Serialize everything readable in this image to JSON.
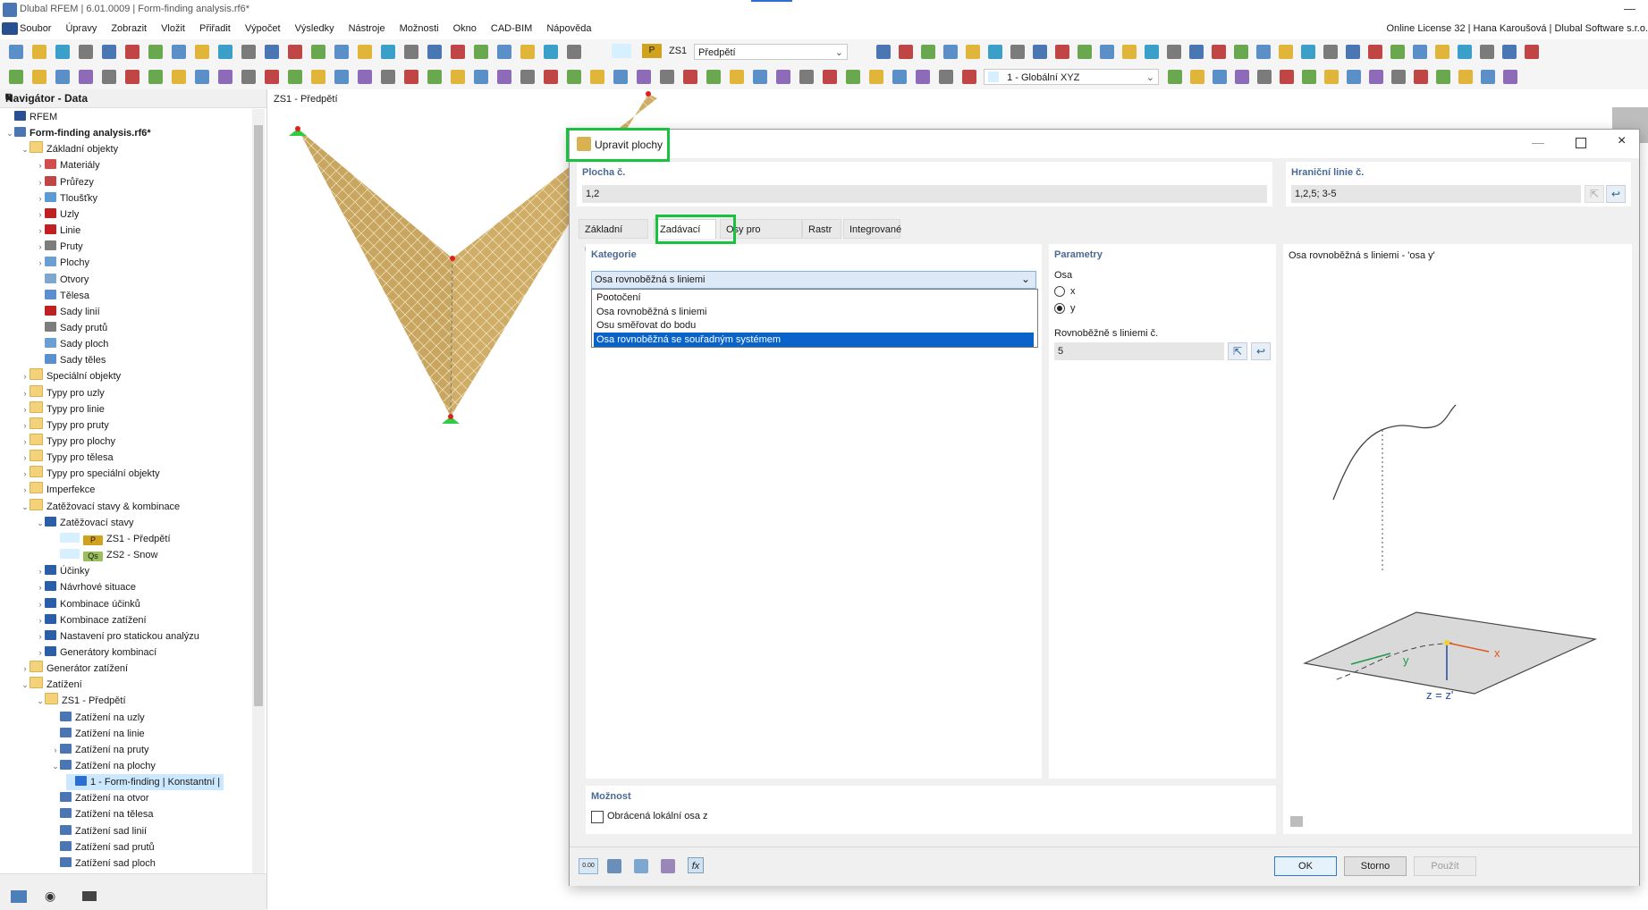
{
  "window": {
    "title": "Dlubal RFEM | 6.01.0009 | Form-finding analysis.rf6*"
  },
  "menu": {
    "items": [
      "Soubor",
      "Úpravy",
      "Zobrazit",
      "Vložit",
      "Přiřadit",
      "Výpočet",
      "Výsledky",
      "Nástroje",
      "Možnosti",
      "Okno",
      "CAD-BIM",
      "Nápověda"
    ],
    "license": "Online License 32 | Hana Karoušová | Dlubal Software s.r.o."
  },
  "toolbar": {
    "load_case_badge": "P",
    "load_case_code": "ZS1",
    "load_case_name": "Předpětí",
    "coord_system": "1 - Globální XYZ"
  },
  "navigator": {
    "title": "Navigátor - Data",
    "rows": [
      {
        "label": "RFEM",
        "indent": 0,
        "tw": "",
        "icon": "rfem",
        "bold": false
      },
      {
        "label": "Form-finding analysis.rf6*",
        "indent": 0,
        "tw": "v",
        "icon": "file",
        "bold": true
      },
      {
        "label": "Základní objekty",
        "indent": 1,
        "tw": "v",
        "icon": "folder"
      },
      {
        "label": "Materiály",
        "indent": 2,
        "tw": ">",
        "icon": "mat"
      },
      {
        "label": "Průřezy",
        "indent": 2,
        "tw": ">",
        "icon": "sec"
      },
      {
        "label": "Tloušťky",
        "indent": 2,
        "tw": ">",
        "icon": "thk"
      },
      {
        "label": "Uzly",
        "indent": 2,
        "tw": ">",
        "icon": "node"
      },
      {
        "label": "Linie",
        "indent": 2,
        "tw": ">",
        "icon": "line"
      },
      {
        "label": "Pruty",
        "indent": 2,
        "tw": ">",
        "icon": "member"
      },
      {
        "label": "Plochy",
        "indent": 2,
        "tw": ">",
        "icon": "surf"
      },
      {
        "label": "Otvory",
        "indent": 2,
        "tw": "",
        "icon": "open"
      },
      {
        "label": "Tělesa",
        "indent": 2,
        "tw": "",
        "icon": "solid"
      },
      {
        "label": "Sady linií",
        "indent": 2,
        "tw": "",
        "icon": "line"
      },
      {
        "label": "Sady prutů",
        "indent": 2,
        "tw": "",
        "icon": "member"
      },
      {
        "label": "Sady ploch",
        "indent": 2,
        "tw": "",
        "icon": "surf"
      },
      {
        "label": "Sady těles",
        "indent": 2,
        "tw": "",
        "icon": "solid"
      },
      {
        "label": "Speciální objekty",
        "indent": 1,
        "tw": ">",
        "icon": "folder"
      },
      {
        "label": "Typy pro uzly",
        "indent": 1,
        "tw": ">",
        "icon": "folder"
      },
      {
        "label": "Typy pro linie",
        "indent": 1,
        "tw": ">",
        "icon": "folder"
      },
      {
        "label": "Typy pro pruty",
        "indent": 1,
        "tw": ">",
        "icon": "folder"
      },
      {
        "label": "Typy pro plochy",
        "indent": 1,
        "tw": ">",
        "icon": "folder"
      },
      {
        "label": "Typy pro tělesa",
        "indent": 1,
        "tw": ">",
        "icon": "folder"
      },
      {
        "label": "Typy pro speciální objekty",
        "indent": 1,
        "tw": ">",
        "icon": "folder"
      },
      {
        "label": "Imperfekce",
        "indent": 1,
        "tw": ">",
        "icon": "folder"
      },
      {
        "label": "Zatěžovací stavy & kombinace",
        "indent": 1,
        "tw": "v",
        "icon": "folder"
      },
      {
        "label": "Zatěžovací stavy",
        "indent": 2,
        "tw": "v",
        "icon": "lc"
      },
      {
        "label": "ZS1 - Předpětí",
        "indent": 3,
        "tw": "",
        "icon": "badgeP",
        "badge": "P"
      },
      {
        "label": "ZS2 - Snow",
        "indent": 3,
        "tw": "",
        "icon": "badgeQs",
        "badge": "Qs"
      },
      {
        "label": "Účinky",
        "indent": 2,
        "tw": ">",
        "icon": "eff"
      },
      {
        "label": "Návrhové situace",
        "indent": 2,
        "tw": ">",
        "icon": "eff"
      },
      {
        "label": "Kombinace účinků",
        "indent": 2,
        "tw": ">",
        "icon": "eff"
      },
      {
        "label": "Kombinace zatížení",
        "indent": 2,
        "tw": ">",
        "icon": "eff"
      },
      {
        "label": "Nastavení pro statickou analýzu",
        "indent": 2,
        "tw": ">",
        "icon": "eff"
      },
      {
        "label": "Generátory kombinací",
        "indent": 2,
        "tw": ">",
        "icon": "eff"
      },
      {
        "label": "Generátor zatížení",
        "indent": 1,
        "tw": ">",
        "icon": "folder"
      },
      {
        "label": "Zatížení",
        "indent": 1,
        "tw": "v",
        "icon": "folder"
      },
      {
        "label": "ZS1 - Předpětí",
        "indent": 2,
        "tw": "v",
        "icon": "folder"
      },
      {
        "label": "Zatížení na uzly",
        "indent": 3,
        "tw": "",
        "icon": "load"
      },
      {
        "label": "Zatížení na linie",
        "indent": 3,
        "tw": "",
        "icon": "load"
      },
      {
        "label": "Zatížení na pruty",
        "indent": 3,
        "tw": ">",
        "icon": "load"
      },
      {
        "label": "Zatížení na plochy",
        "indent": 3,
        "tw": "v",
        "icon": "load"
      },
      {
        "label": "1 - Form-finding | Konstantní |",
        "indent": 4,
        "tw": "",
        "icon": "sq",
        "selected": true
      },
      {
        "label": "Zatížení na otvor",
        "indent": 3,
        "tw": "",
        "icon": "load"
      },
      {
        "label": "Zatížení na tělesa",
        "indent": 3,
        "tw": "",
        "icon": "load"
      },
      {
        "label": "Zatížení sad linií",
        "indent": 3,
        "tw": "",
        "icon": "load"
      },
      {
        "label": "Zatížení sad prutů",
        "indent": 3,
        "tw": "",
        "icon": "load"
      },
      {
        "label": "Zatížení sad ploch",
        "indent": 3,
        "tw": "",
        "icon": "load"
      }
    ]
  },
  "viewport": {
    "label": "ZS1 - Předpětí"
  },
  "dialog": {
    "title": "Upravit plochy",
    "surface_no_label": "Plocha č.",
    "surface_no_value": "1,2",
    "boundary_label": "Hraniční linie č.",
    "boundary_value": "1,2,5; 3-5",
    "tabs": [
      "Základní údaje",
      "Zadávací osy",
      "Osy pro výsledky",
      "Rastr",
      "Integrované"
    ],
    "active_tab": 1,
    "category": {
      "label": "Kategorie",
      "selected": "Osa rovnoběžná s liniemi",
      "options": [
        "Pootočení",
        "Osa rovnoběžná s liniemi",
        "Osu směřovat do bodu",
        "Osa rovnoběžná se souřadným systémem"
      ],
      "highlighted": 3
    },
    "parameters": {
      "label": "Parametry",
      "axis_label": "Osa",
      "axis_options": [
        "x",
        "y"
      ],
      "axis_selected": "y",
      "parallel_label": "Rovnoběžně s liniemi č.",
      "parallel_value": "5"
    },
    "preview": {
      "caption": "Osa rovnoběžná s liniemi - 'osa y'",
      "axis_x": "x",
      "axis_y": "y",
      "axis_z": "z = z'"
    },
    "option": {
      "label": "Možnost",
      "checkbox_label": "Obrácená lokální osa z",
      "checked": false
    },
    "footer": {
      "zero_badge": "0.00",
      "ok": "OK",
      "cancel": "Storno",
      "apply": "Použít"
    }
  }
}
